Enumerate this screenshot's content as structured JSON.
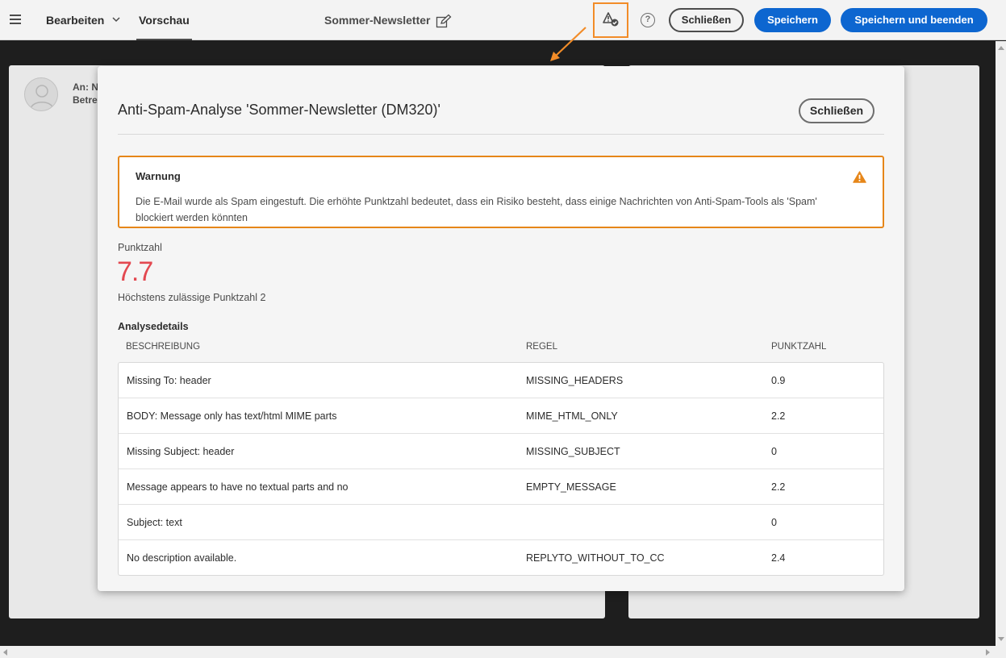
{
  "topbar": {
    "edit_label": "Bearbeiten",
    "preview_label": "Vorschau",
    "title": "Sommer-Newsletter",
    "close_label": "Schließen",
    "save_label": "Speichern",
    "save_exit_label": "Speichern und beenden",
    "help_glyph": "?",
    "icons": [
      "menu-icon",
      "chevron-down-icon",
      "pencil-icon",
      "spam-check-icon",
      "help-icon"
    ]
  },
  "background_panel": {
    "to_label": "An: N",
    "subject_label": "Betre"
  },
  "modal": {
    "title": "Anti-Spam-Analyse 'Sommer-Newsletter (DM320)'",
    "close_label": "Schließen",
    "warning": {
      "title": "Warnung",
      "text": "Die E-Mail wurde als Spam eingestuft. Die erhöhte Punktzahl bedeutet, dass ein Risiko besteht, dass einige Nachrichten von Anti-Spam-Tools als 'Spam' blockiert werden könnten",
      "color": "#e68619"
    },
    "score_label": "Punktzahl",
    "score_value": "7.7",
    "score_color": "#e34850",
    "max_score_text": "Höchstens zulässige Punktzahl 2",
    "details_label": "Analysedetails",
    "columns": [
      "Beschreibung",
      "Regel",
      "Punktzahl"
    ],
    "rows": [
      {
        "description": "Missing To: header",
        "rule": "MISSING_HEADERS",
        "score": "0.9"
      },
      {
        "description": "BODY: Message only has text/html MIME parts",
        "rule": "MIME_HTML_ONLY",
        "score": "2.2"
      },
      {
        "description": "Missing Subject: header",
        "rule": "MISSING_SUBJECT",
        "score": "0"
      },
      {
        "description": "Message appears to have no textual parts and no",
        "rule": "EMPTY_MESSAGE",
        "score": "2.2"
      },
      {
        "description": "Subject: text",
        "rule": "",
        "score": "0"
      },
      {
        "description": "No description available.",
        "rule": "REPLYTO_WITHOUT_TO_CC",
        "score": "2.4"
      }
    ]
  },
  "colors": {
    "accent_blue": "#0d66d0",
    "highlight_orange": "#f28c28"
  }
}
